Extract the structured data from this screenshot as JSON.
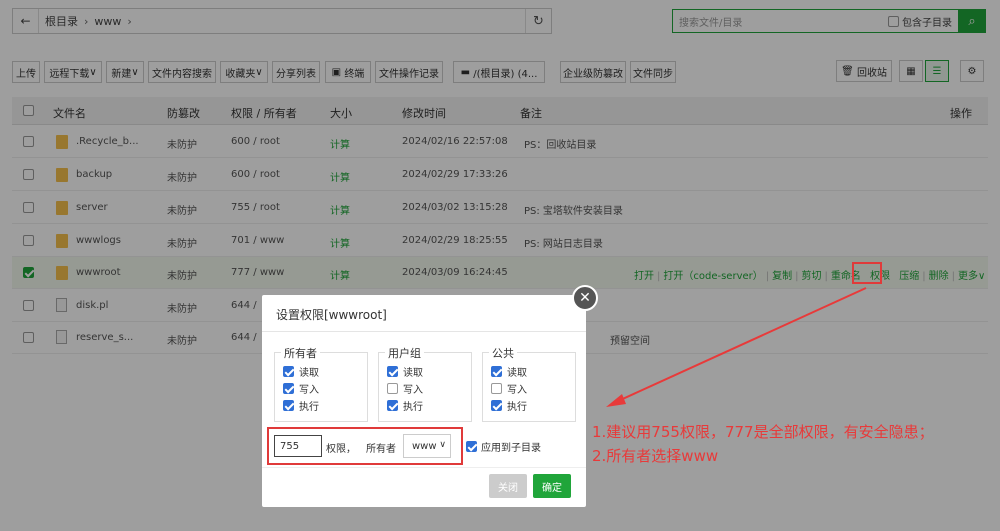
{
  "path": {
    "crumbs": [
      "根目录",
      "www"
    ]
  },
  "search": {
    "placeholder": "搜索文件/目录",
    "include_sub": "包含子目录"
  },
  "toolbar": {
    "upload": "上传",
    "remote_download": "远程下载",
    "new": "新建",
    "content_search": "文件内容搜索",
    "favorites": "收藏夹",
    "share_list": "分享列表",
    "terminal": "终端",
    "file_log": "文件操作记录",
    "disk": "/(根目录) (4...",
    "tamper": "企业级防篡改",
    "sync": "文件同步",
    "recycle": "回收站"
  },
  "table": {
    "headers": {
      "name": "文件名",
      "protect": "防篡改",
      "perm": "权限 / 所有者",
      "size": "大小",
      "mtime": "修改时间",
      "note": "备注",
      "ops": "操作"
    },
    "rows": [
      {
        "name": ".Recycle_b...",
        "protect": "未防护",
        "perm": "600 / root",
        "size": "计算",
        "mtime": "2024/02/16 22:57:08",
        "note": "PS：回收站目录"
      },
      {
        "name": "backup",
        "protect": "未防护",
        "perm": "600 / root",
        "size": "计算",
        "mtime": "2024/02/29 17:33:26",
        "note": ""
      },
      {
        "name": "server",
        "protect": "未防护",
        "perm": "755 / root",
        "size": "计算",
        "mtime": "2024/03/02 13:15:28",
        "note": "PS: 宝塔软件安装目录"
      },
      {
        "name": "wwwlogs",
        "protect": "未防护",
        "perm": "701 / www",
        "size": "计算",
        "mtime": "2024/02/29 18:25:55",
        "note": "PS: 网站日志目录"
      },
      {
        "name": "wwwroot",
        "protect": "未防护",
        "perm": "777 / www",
        "size": "计算",
        "mtime": "2024/03/09 16:24:45",
        "note": ""
      },
      {
        "name": "disk.pl",
        "protect": "未防护",
        "perm": "644 /",
        "size": "",
        "mtime": "",
        "note": ""
      },
      {
        "name": "reserve_s...",
        "protect": "未防护",
        "perm": "644 /",
        "size": "",
        "mtime": "",
        "note": "预留空间"
      }
    ],
    "row_ops": {
      "open": "打开",
      "open_code": "打开（code-server）",
      "copy": "复制",
      "cut": "剪切",
      "rename": "重命名",
      "perm": "权限",
      "zip": "压缩",
      "delete": "删除",
      "more": "更多"
    }
  },
  "dialog": {
    "title": "设置权限[wwwroot]",
    "owner": {
      "title": "所有者",
      "read": "读取",
      "write": "写入",
      "exec": "执行"
    },
    "group": {
      "title": "用户组",
      "read": "读取",
      "write": "写入",
      "exec": "执行"
    },
    "public": {
      "title": "公共",
      "read": "读取",
      "write": "写入",
      "exec": "执行"
    },
    "perm_value": "755",
    "perm_label": "权限，",
    "owner_label": "所有者",
    "owner_value": "www",
    "apply_sub": "应用到子目录",
    "close_btn": "关闭",
    "ok_btn": "确定"
  },
  "annotation": {
    "line1": "1.建议用755权限，777是全部权限，有安全隐患；",
    "line2": "2.所有者选择www"
  },
  "colors": {
    "accent": "#20a53a",
    "annotation": "#e83a3a"
  }
}
